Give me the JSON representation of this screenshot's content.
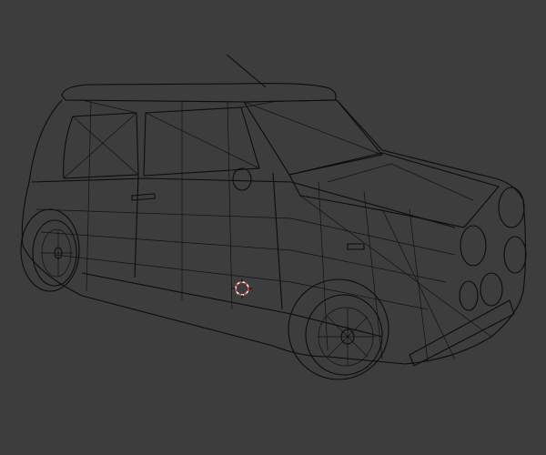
{
  "viewport": {
    "mode": "wireframe",
    "object": "car-mesh",
    "background_color": "#3d3d3d",
    "wire_color": "#0c0c0c",
    "cursor_colors": [
      "#e03030",
      "#ffffff"
    ]
  }
}
